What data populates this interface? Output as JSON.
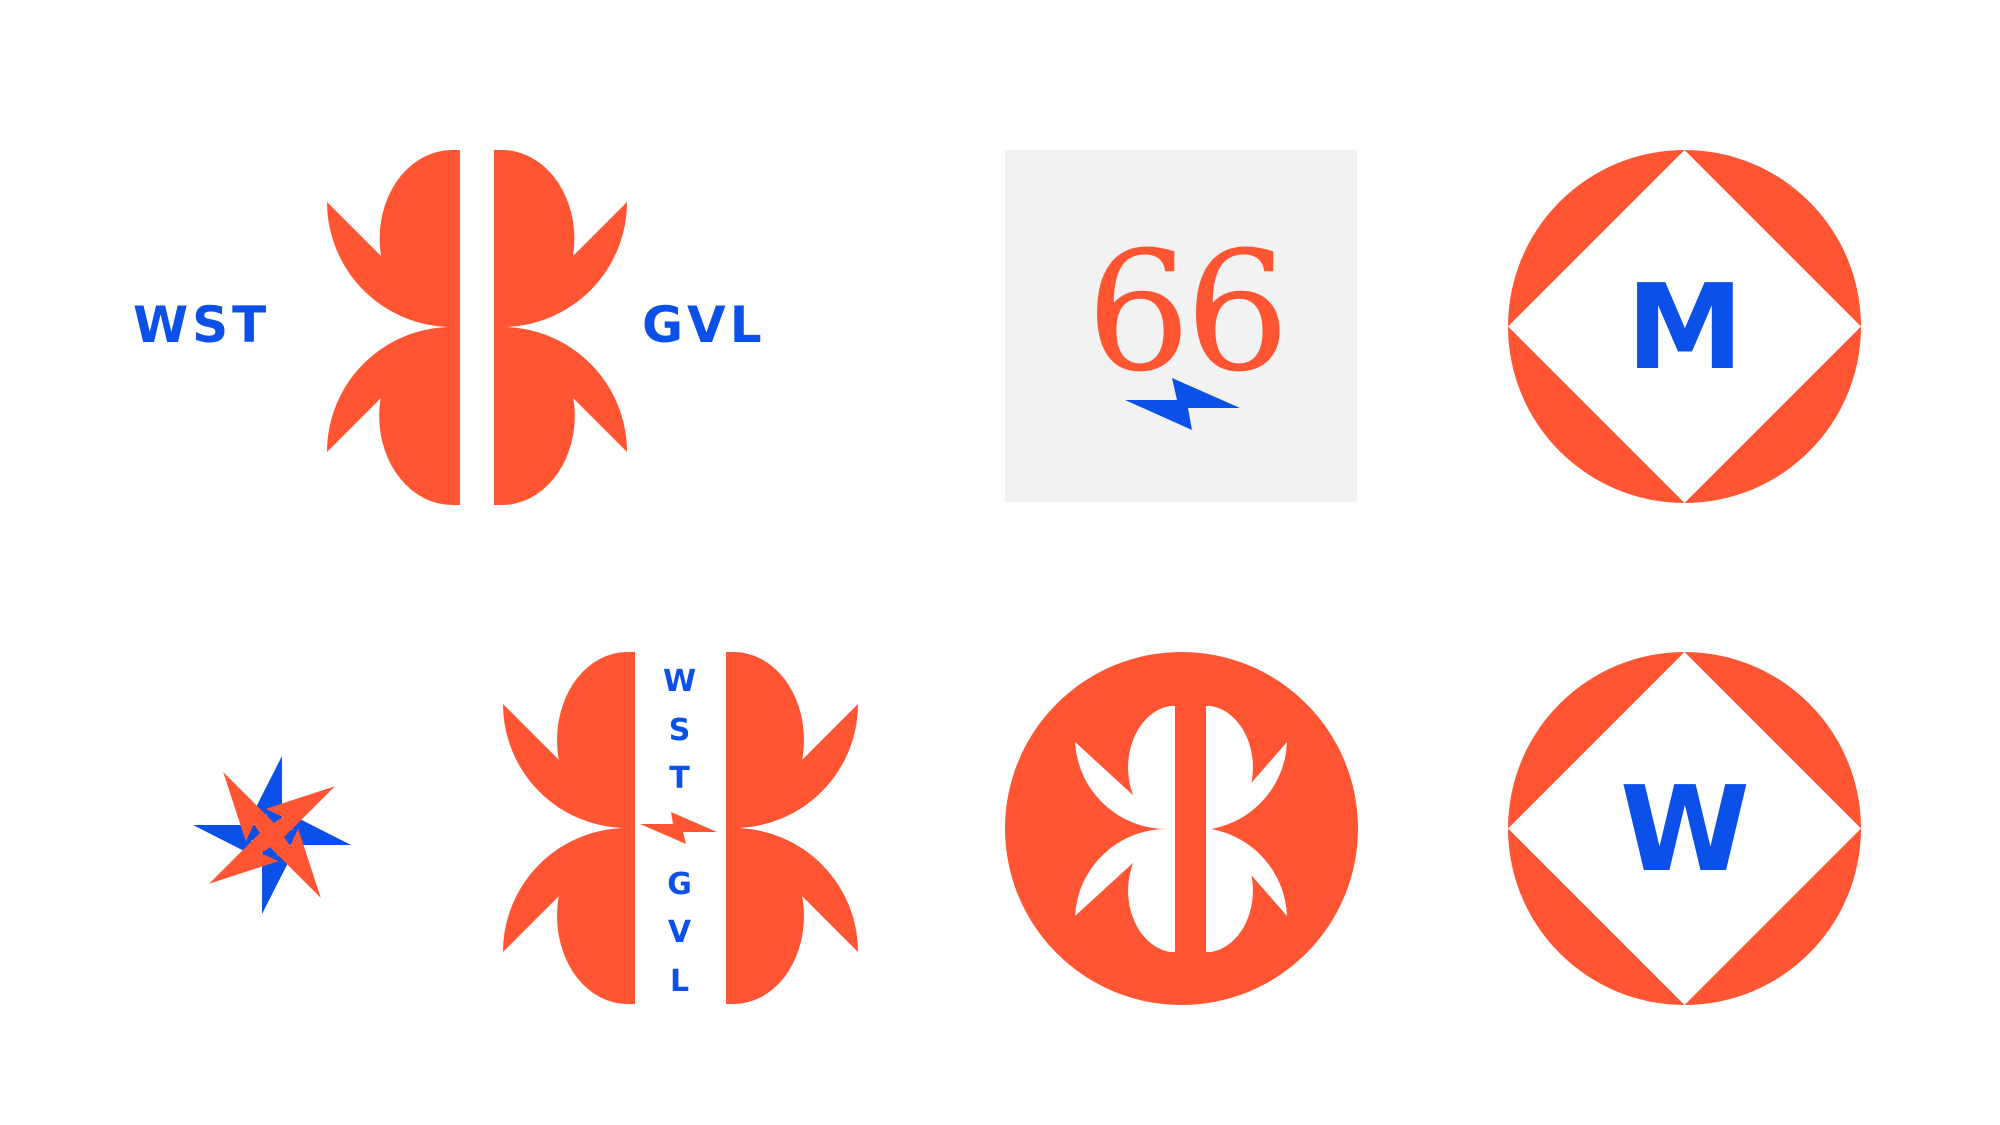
{
  "colors": {
    "accent": "#ff5533",
    "blue": "#0b50e8",
    "panel": "#f2f2f2",
    "background": "#ffffff"
  },
  "logos": {
    "primary": {
      "left_text": "WST",
      "right_text": "GVL"
    },
    "number_mark": {
      "text": "66",
      "icon": "lightning-bolt-icon"
    },
    "monogram_m": {
      "letter": "M"
    },
    "monogram_w": {
      "letter": "W"
    },
    "bolt_burst": {
      "icon": "lightning-burst-icon"
    },
    "vertical": {
      "letters_top": [
        "W",
        "S",
        "T"
      ],
      "letters_bottom": [
        "G",
        "V",
        "L"
      ]
    },
    "circle_badge": {
      "icon": "petal-emblem-icon"
    }
  }
}
